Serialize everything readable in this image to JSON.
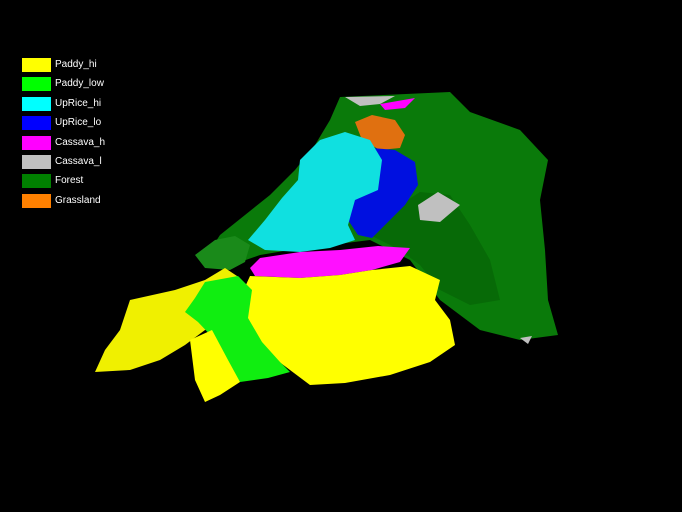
{
  "background": "#000000",
  "legend": {
    "items": [
      {
        "label": "Paddy_hi",
        "color": "#ffff00"
      },
      {
        "label": "Paddy_low",
        "color": "#00ff00"
      },
      {
        "label": "UpRice_hi",
        "color": "#00ffff"
      },
      {
        "label": "UpRice_lo",
        "color": "#0000ff"
      },
      {
        "label": "Cassava_h",
        "color": "#ff00ff"
      },
      {
        "label": "Cassava_l",
        "color": "#c0c0c0"
      },
      {
        "label": "Forest",
        "color": "#008000"
      },
      {
        "label": "Grassland",
        "color": "#ff8000"
      }
    ]
  }
}
